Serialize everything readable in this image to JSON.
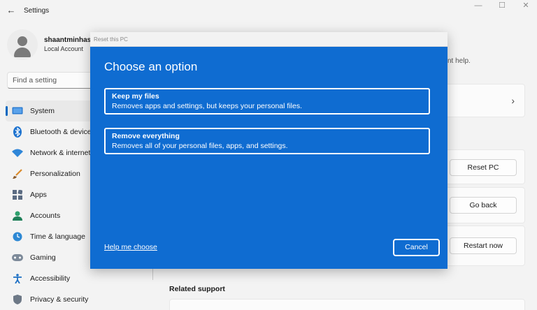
{
  "window": {
    "title": "Settings",
    "controls": {
      "minimize": "—",
      "maximize": "☐",
      "close": "✕"
    }
  },
  "profile": {
    "name": "shaantminhas",
    "account": "Local Account"
  },
  "search": {
    "placeholder": "Find a setting"
  },
  "sidebar": {
    "items": [
      {
        "label": "System",
        "icon": "monitor-icon",
        "active": true
      },
      {
        "label": "Bluetooth & devices",
        "icon": "bluetooth-icon"
      },
      {
        "label": "Network & internet",
        "icon": "wifi-icon"
      },
      {
        "label": "Personalization",
        "icon": "brush-icon"
      },
      {
        "label": "Apps",
        "icon": "apps-icon"
      },
      {
        "label": "Accounts",
        "icon": "person-icon"
      },
      {
        "label": "Time & language",
        "icon": "clock-globe-icon"
      },
      {
        "label": "Gaming",
        "icon": "gamepad-icon"
      },
      {
        "label": "Accessibility",
        "icon": "accessibility-icon"
      },
      {
        "label": "Privacy & security",
        "icon": "shield-icon"
      }
    ]
  },
  "main": {
    "help_text_fragment": "nt help.",
    "reset_button": "Reset PC",
    "go_back_button": "Go back",
    "restart_button": "Restart now",
    "related_support": "Related support"
  },
  "dialog": {
    "window_title": "Reset this PC",
    "heading": "Choose an option",
    "options": [
      {
        "title": "Keep my files",
        "description": "Removes apps and settings, but keeps your personal files."
      },
      {
        "title": "Remove everything",
        "description": "Removes all of your personal files, apps, and settings."
      }
    ],
    "help_link": "Help me choose",
    "cancel": "Cancel"
  },
  "colors": {
    "accent": "#0067c0",
    "dialog_bg": "#0f6cd1"
  }
}
